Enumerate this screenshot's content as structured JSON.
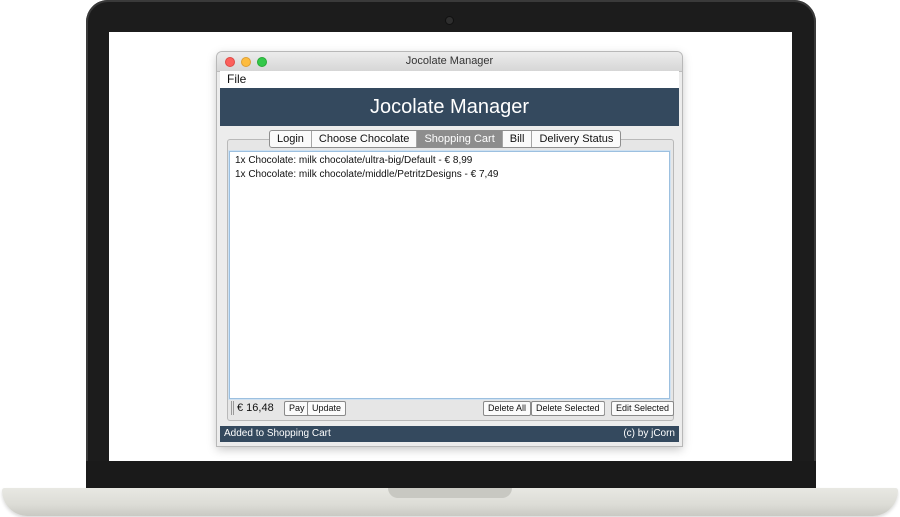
{
  "window": {
    "title": "Jocolate Manager"
  },
  "menubar": {
    "file": "File"
  },
  "banner": {
    "title": "Jocolate Manager"
  },
  "tabs": [
    {
      "label": "Login",
      "active": false
    },
    {
      "label": "Choose Chocolate",
      "active": false
    },
    {
      "label": "Shopping Cart",
      "active": true
    },
    {
      "label": "Bill",
      "active": false
    },
    {
      "label": "Delivery Status",
      "active": false
    }
  ],
  "cart": {
    "items": [
      "1x Chocolate: milk chocolate/ultra-big/Default - € 8,99",
      "1x Chocolate: milk chocolate/middle/PetritzDesigns - € 7,49"
    ],
    "total": "€ 16,48",
    "buttons": {
      "pay": "Pay",
      "update": "Update",
      "delete_all": "Delete All",
      "delete_selected": "Delete Selected",
      "edit_selected": "Edit Selected"
    }
  },
  "status": {
    "message": "Added to Shopping Cart",
    "credit": "(c) by jCorn"
  },
  "colors": {
    "banner_bg": "#34495e",
    "active_tab": "#8d8d8d",
    "list_border": "#9cc0e0"
  }
}
